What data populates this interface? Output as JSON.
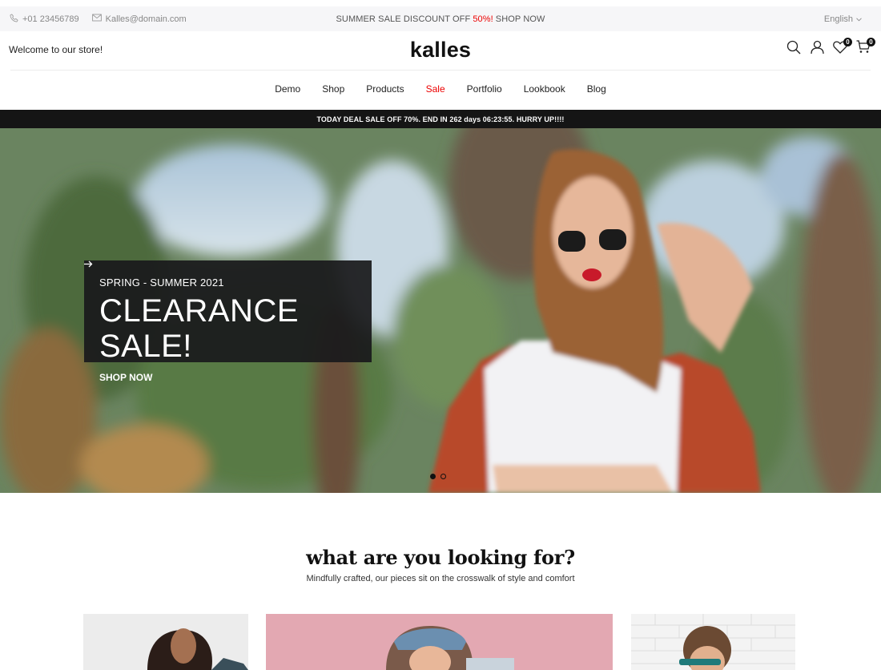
{
  "topbar": {
    "phone": "+01 23456789",
    "email": "Kalles@domain.com",
    "promo_text": "SUMMER SALE DISCOUNT OFF",
    "promo_percent": "50%!",
    "promo_link": "SHOP NOW",
    "language": "English"
  },
  "header": {
    "welcome": "Welcome to our store!",
    "logo": "kalles",
    "wishlist_count": "0",
    "cart_count": "0"
  },
  "nav": {
    "items": [
      "Demo",
      "Shop",
      "Products",
      "Sale",
      "Portfolio",
      "Lookbook",
      "Blog"
    ]
  },
  "deal_bar": {
    "text": "TODAY DEAL SALE OFF 70%. END IN 262 days 06:23:55. HURRY UP!!!!"
  },
  "hero": {
    "subtitle": "SPRING - SUMMER 2021",
    "title": "CLEARANCE SALE!",
    "cta": "SHOP NOW"
  },
  "categories_section": {
    "title": "what are you looking for?",
    "subtitle": "Mindfully crafted, our pieces sit on the crosswalk of style and comfort"
  },
  "colors": {
    "accent": "#ec0101",
    "dark": "#151515"
  }
}
